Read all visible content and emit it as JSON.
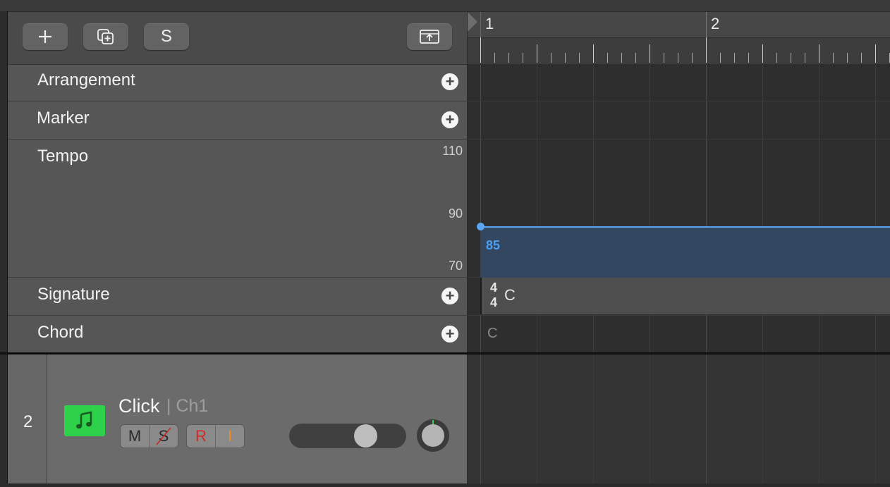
{
  "toolbar": {
    "add_track_icon": "plus-icon",
    "duplicate_icon": "duplicate-track-icon",
    "s_label": "S",
    "upload_icon": "tray-up-icon"
  },
  "global_tracks": {
    "arrangement": "Arrangement",
    "marker": "Marker",
    "tempo": "Tempo",
    "tempo_scale": [
      "110",
      "90",
      "70"
    ],
    "signature": "Signature",
    "chord": "Chord",
    "plus_label": "+"
  },
  "ruler": {
    "bars": [
      "1",
      "2"
    ]
  },
  "timeline": {
    "tempo_value": "85",
    "signature_top": "4",
    "signature_bottom": "4",
    "key": "C",
    "chord": "C"
  },
  "track": {
    "number": "2",
    "name": "Click",
    "channel": "| Ch1",
    "mute": "M",
    "solo": "S",
    "record": "R",
    "input": "I",
    "icon": "music-note-icon",
    "volume_level": 0.7,
    "accent": "#2ed24a"
  },
  "colors": {
    "tempo_line": "#5aa4f2",
    "tempo_fill": "#344761",
    "record": "#d42a2a",
    "input": "#f08a1e"
  }
}
